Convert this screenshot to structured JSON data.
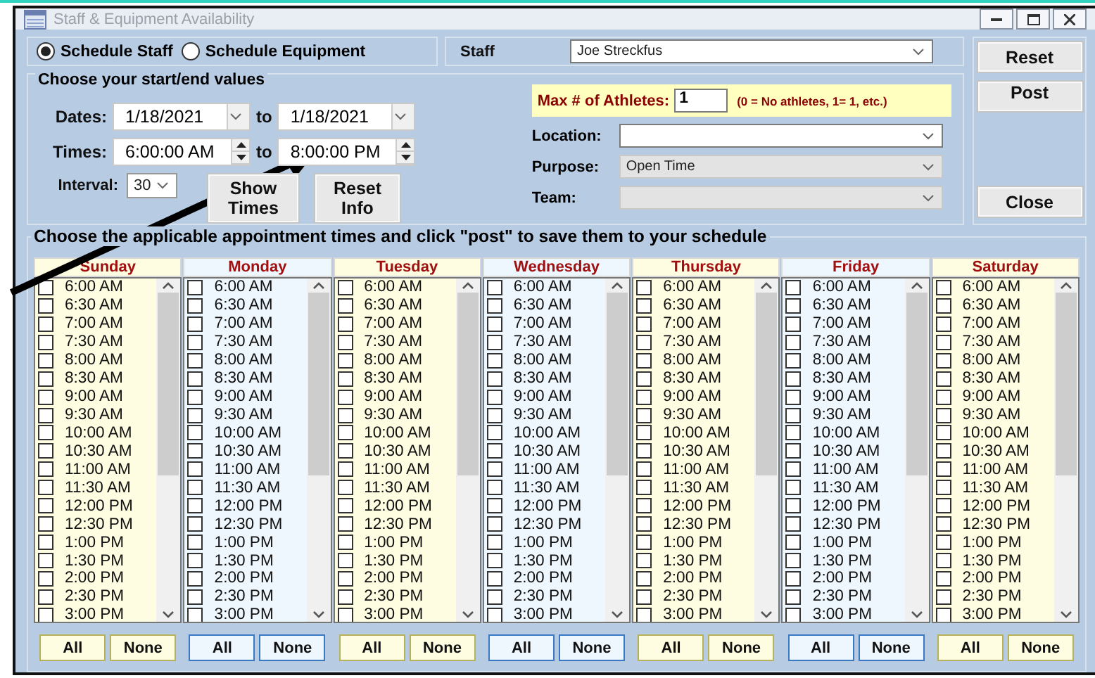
{
  "window": {
    "title": "Staff & Equipment Availability"
  },
  "mode": [
    {
      "label": "Schedule Staff",
      "selected": true
    },
    {
      "label": "Schedule Equipment",
      "selected": false
    }
  ],
  "staff": {
    "label": "Staff",
    "value": "Joe Streckfus"
  },
  "actions": [
    "Reset",
    "Post",
    "Close"
  ],
  "range": {
    "title": "Choose your start/end values",
    "dates": {
      "label": "Dates:",
      "from": "1/18/2021",
      "sep": "to",
      "to": "1/18/2021"
    },
    "times": {
      "label": "Times:",
      "from": "6:00:00 AM",
      "sep": "to",
      "to": "8:00:00 PM"
    },
    "interval": {
      "label": "Interval:",
      "value": "30"
    },
    "buttons": [
      "Show Times",
      "Reset Info"
    ]
  },
  "max_athletes": {
    "label": "Max # of Athletes:",
    "value": "1",
    "hint": "(0 = No athletes, 1= 1, etc.)"
  },
  "fields": [
    {
      "label": "Location:",
      "disabled": false
    },
    {
      "label": "Purpose:",
      "value": "Open Time",
      "disabled": true
    },
    {
      "label": "Team:",
      "disabled": true
    }
  ],
  "schedule": {
    "title": "Choose the applicable appointment times and click \"post\" to save them to your schedule",
    "days": [
      {
        "name": "Sunday",
        "color": "#fffde1",
        "buttons": [
          "All",
          "None"
        ],
        "slots": [
          {
            "time": "6:00 AM",
            "checked": false
          },
          {
            "time": "6:30 AM",
            "checked": false
          },
          {
            "time": "7:00 AM",
            "checked": false
          },
          {
            "time": "7:30 AM",
            "checked": false
          },
          {
            "time": "8:00 AM",
            "checked": false
          },
          {
            "time": "8:30 AM",
            "checked": false
          },
          {
            "time": "9:00 AM",
            "checked": false
          },
          {
            "time": "9:30 AM",
            "checked": false
          },
          {
            "time": "10:00 AM",
            "checked": false
          },
          {
            "time": "10:30 AM",
            "checked": false
          },
          {
            "time": "11:00 AM",
            "checked": false
          },
          {
            "time": "11:30 AM",
            "checked": false
          },
          {
            "time": "12:00 PM",
            "checked": false
          },
          {
            "time": "12:30 PM",
            "checked": false
          },
          {
            "time": "1:00 PM",
            "checked": false
          },
          {
            "time": "1:30 PM",
            "checked": false
          },
          {
            "time": "2:00 PM",
            "checked": false
          },
          {
            "time": "2:30 PM",
            "checked": false
          },
          {
            "time": "3:00 PM",
            "checked": false
          }
        ]
      },
      {
        "name": "Monday",
        "color": "#eef6fe",
        "buttons": [
          "All",
          "None"
        ],
        "slots": [
          {
            "time": "6:00 AM",
            "checked": false
          },
          {
            "time": "6:30 AM",
            "checked": false
          },
          {
            "time": "7:00 AM",
            "checked": false
          },
          {
            "time": "7:30 AM",
            "checked": false
          },
          {
            "time": "8:00 AM",
            "checked": false
          },
          {
            "time": "8:30 AM",
            "checked": false
          },
          {
            "time": "9:00 AM",
            "checked": false
          },
          {
            "time": "9:30 AM",
            "checked": false
          },
          {
            "time": "10:00 AM",
            "checked": false
          },
          {
            "time": "10:30 AM",
            "checked": false
          },
          {
            "time": "11:00 AM",
            "checked": false
          },
          {
            "time": "11:30 AM",
            "checked": false
          },
          {
            "time": "12:00 PM",
            "checked": false
          },
          {
            "time": "12:30 PM",
            "checked": false
          },
          {
            "time": "1:00 PM",
            "checked": false
          },
          {
            "time": "1:30 PM",
            "checked": false
          },
          {
            "time": "2:00 PM",
            "checked": false
          },
          {
            "time": "2:30 PM",
            "checked": false
          },
          {
            "time": "3:00 PM",
            "checked": false
          }
        ]
      },
      {
        "name": "Tuesday",
        "color": "#fffde1",
        "buttons": [
          "All",
          "None"
        ],
        "slots": [
          {
            "time": "6:00 AM",
            "checked": false
          },
          {
            "time": "6:30 AM",
            "checked": false
          },
          {
            "time": "7:00 AM",
            "checked": false
          },
          {
            "time": "7:30 AM",
            "checked": false
          },
          {
            "time": "8:00 AM",
            "checked": false
          },
          {
            "time": "8:30 AM",
            "checked": false
          },
          {
            "time": "9:00 AM",
            "checked": false
          },
          {
            "time": "9:30 AM",
            "checked": false
          },
          {
            "time": "10:00 AM",
            "checked": false
          },
          {
            "time": "10:30 AM",
            "checked": false
          },
          {
            "time": "11:00 AM",
            "checked": false
          },
          {
            "time": "11:30 AM",
            "checked": false
          },
          {
            "time": "12:00 PM",
            "checked": false
          },
          {
            "time": "12:30 PM",
            "checked": false
          },
          {
            "time": "1:00 PM",
            "checked": false
          },
          {
            "time": "1:30 PM",
            "checked": false
          },
          {
            "time": "2:00 PM",
            "checked": false
          },
          {
            "time": "2:30 PM",
            "checked": false
          },
          {
            "time": "3:00 PM",
            "checked": false
          }
        ]
      },
      {
        "name": "Wednesday",
        "color": "#eef6fe",
        "buttons": [
          "All",
          "None"
        ],
        "slots": [
          {
            "time": "6:00 AM",
            "checked": false
          },
          {
            "time": "6:30 AM",
            "checked": false
          },
          {
            "time": "7:00 AM",
            "checked": false
          },
          {
            "time": "7:30 AM",
            "checked": false
          },
          {
            "time": "8:00 AM",
            "checked": false
          },
          {
            "time": "8:30 AM",
            "checked": false
          },
          {
            "time": "9:00 AM",
            "checked": false
          },
          {
            "time": "9:30 AM",
            "checked": false
          },
          {
            "time": "10:00 AM",
            "checked": false
          },
          {
            "time": "10:30 AM",
            "checked": false
          },
          {
            "time": "11:00 AM",
            "checked": false
          },
          {
            "time": "11:30 AM",
            "checked": false
          },
          {
            "time": "12:00 PM",
            "checked": false
          },
          {
            "time": "12:30 PM",
            "checked": false
          },
          {
            "time": "1:00 PM",
            "checked": false
          },
          {
            "time": "1:30 PM",
            "checked": false
          },
          {
            "time": "2:00 PM",
            "checked": false
          },
          {
            "time": "2:30 PM",
            "checked": false
          },
          {
            "time": "3:00 PM",
            "checked": false
          }
        ]
      },
      {
        "name": "Thursday",
        "color": "#fffde1",
        "buttons": [
          "All",
          "None"
        ],
        "slots": [
          {
            "time": "6:00 AM",
            "checked": false
          },
          {
            "time": "6:30 AM",
            "checked": false
          },
          {
            "time": "7:00 AM",
            "checked": false
          },
          {
            "time": "7:30 AM",
            "checked": false
          },
          {
            "time": "8:00 AM",
            "checked": false
          },
          {
            "time": "8:30 AM",
            "checked": false
          },
          {
            "time": "9:00 AM",
            "checked": false
          },
          {
            "time": "9:30 AM",
            "checked": false
          },
          {
            "time": "10:00 AM",
            "checked": false
          },
          {
            "time": "10:30 AM",
            "checked": false
          },
          {
            "time": "11:00 AM",
            "checked": false
          },
          {
            "time": "11:30 AM",
            "checked": false
          },
          {
            "time": "12:00 PM",
            "checked": false
          },
          {
            "time": "12:30 PM",
            "checked": false
          },
          {
            "time": "1:00 PM",
            "checked": false
          },
          {
            "time": "1:30 PM",
            "checked": false
          },
          {
            "time": "2:00 PM",
            "checked": false
          },
          {
            "time": "2:30 PM",
            "checked": false
          },
          {
            "time": "3:00 PM",
            "checked": false
          }
        ]
      },
      {
        "name": "Friday",
        "color": "#eef6fe",
        "buttons": [
          "All",
          "None"
        ],
        "slots": [
          {
            "time": "6:00 AM",
            "checked": false
          },
          {
            "time": "6:30 AM",
            "checked": false
          },
          {
            "time": "7:00 AM",
            "checked": false
          },
          {
            "time": "7:30 AM",
            "checked": false
          },
          {
            "time": "8:00 AM",
            "checked": false
          },
          {
            "time": "8:30 AM",
            "checked": false
          },
          {
            "time": "9:00 AM",
            "checked": false
          },
          {
            "time": "9:30 AM",
            "checked": false
          },
          {
            "time": "10:00 AM",
            "checked": false
          },
          {
            "time": "10:30 AM",
            "checked": false
          },
          {
            "time": "11:00 AM",
            "checked": false
          },
          {
            "time": "11:30 AM",
            "checked": false
          },
          {
            "time": "12:00 PM",
            "checked": false
          },
          {
            "time": "12:30 PM",
            "checked": false
          },
          {
            "time": "1:00 PM",
            "checked": false
          },
          {
            "time": "1:30 PM",
            "checked": false
          },
          {
            "time": "2:00 PM",
            "checked": false
          },
          {
            "time": "2:30 PM",
            "checked": false
          },
          {
            "time": "3:00 PM",
            "checked": false
          }
        ]
      },
      {
        "name": "Saturday",
        "color": "#fffde1",
        "buttons": [
          "All",
          "None"
        ],
        "slots": [
          {
            "time": "6:00 AM",
            "checked": false
          },
          {
            "time": "6:30 AM",
            "checked": false
          },
          {
            "time": "7:00 AM",
            "checked": false
          },
          {
            "time": "7:30 AM",
            "checked": false
          },
          {
            "time": "8:00 AM",
            "checked": false
          },
          {
            "time": "8:30 AM",
            "checked": false
          },
          {
            "time": "9:00 AM",
            "checked": false
          },
          {
            "time": "9:30 AM",
            "checked": false
          },
          {
            "time": "10:00 AM",
            "checked": false
          },
          {
            "time": "10:30 AM",
            "checked": false
          },
          {
            "time": "11:00 AM",
            "checked": false
          },
          {
            "time": "11:30 AM",
            "checked": false
          },
          {
            "time": "12:00 PM",
            "checked": false
          },
          {
            "time": "12:30 PM",
            "checked": false
          },
          {
            "time": "1:00 PM",
            "checked": false
          },
          {
            "time": "1:30 PM",
            "checked": false
          },
          {
            "time": "2:00 PM",
            "checked": false
          },
          {
            "time": "2:30 PM",
            "checked": false
          },
          {
            "time": "3:00 PM",
            "checked": false
          }
        ]
      }
    ]
  }
}
